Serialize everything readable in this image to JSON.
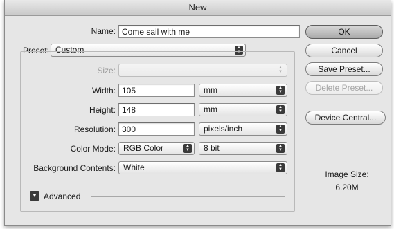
{
  "dialog": {
    "title": "New"
  },
  "name": {
    "label": "Name:",
    "value": "Come sail with me"
  },
  "preset": {
    "label": "Preset:",
    "value": "Custom"
  },
  "size": {
    "label": "Size:",
    "value": ""
  },
  "width": {
    "label": "Width:",
    "value": "105",
    "unit": "mm"
  },
  "height": {
    "label": "Height:",
    "value": "148",
    "unit": "mm"
  },
  "resolution": {
    "label": "Resolution:",
    "value": "300",
    "unit": "pixels/inch"
  },
  "color_mode": {
    "label": "Color Mode:",
    "value": "RGB Color",
    "depth": "8 bit"
  },
  "background": {
    "label": "Background Contents:",
    "value": "White"
  },
  "advanced": {
    "label": "Advanced"
  },
  "buttons": {
    "ok": "OK",
    "cancel": "Cancel",
    "save_preset": "Save Preset...",
    "delete_preset": "Delete Preset...",
    "device_central": "Device Central..."
  },
  "image_size": {
    "label": "Image Size:",
    "value": "6.20M"
  },
  "icons": {
    "popup_arrows": "up-down-arrows-icon",
    "disclosure": "disclosure-triangle-icon"
  }
}
